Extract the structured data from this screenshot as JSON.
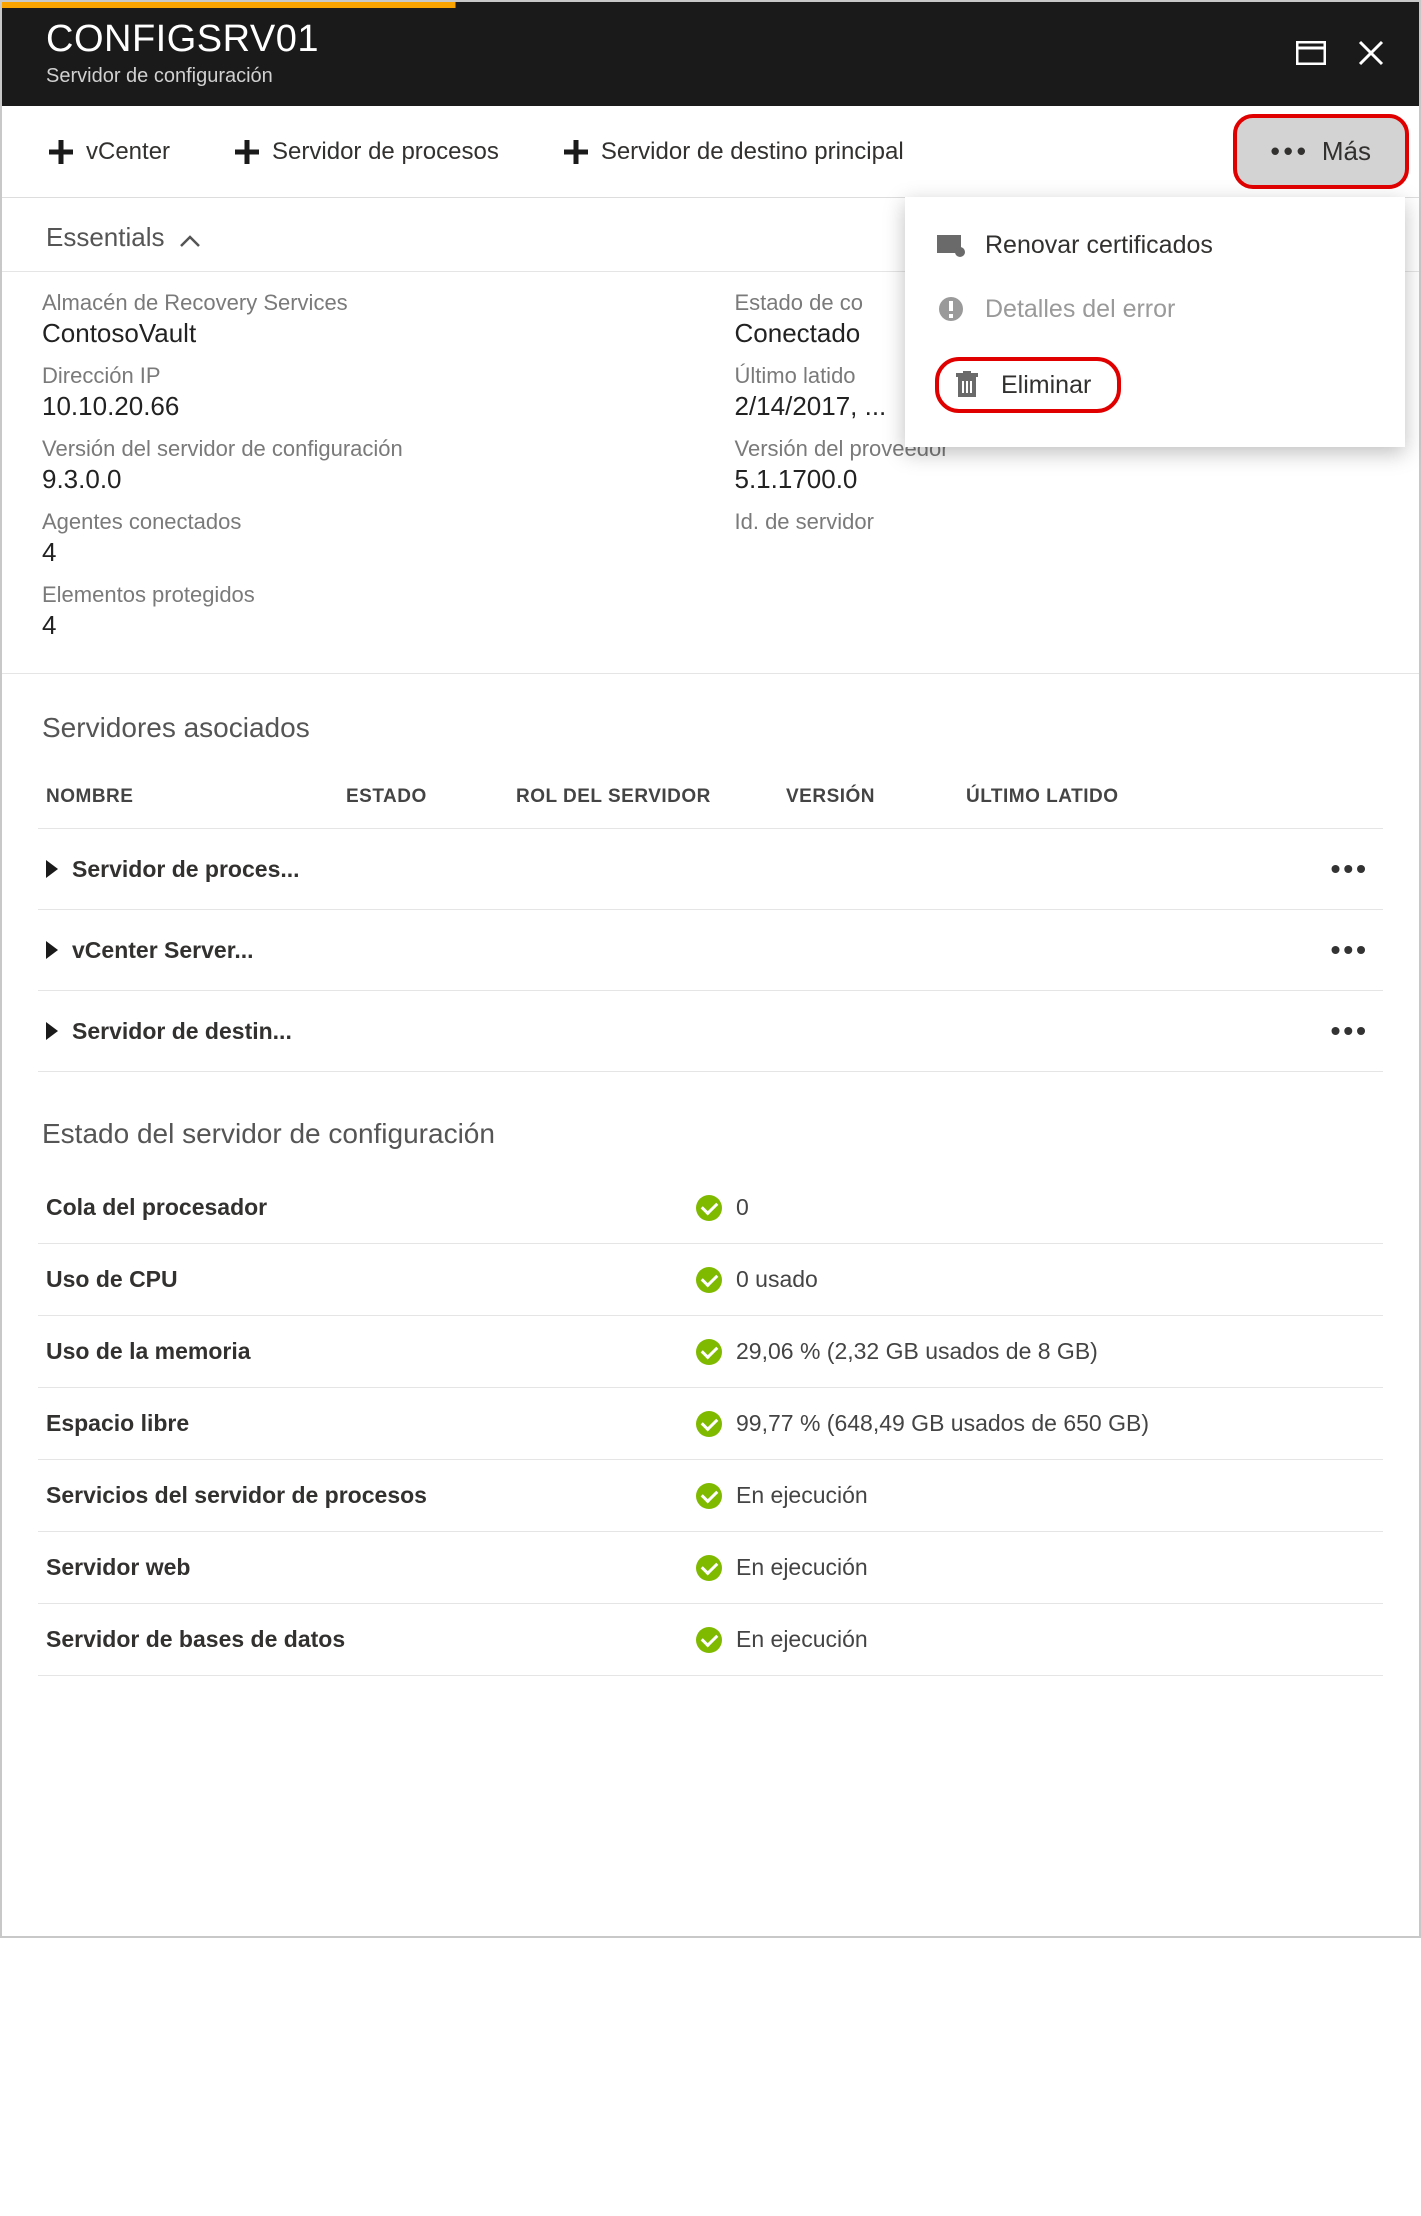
{
  "header": {
    "title": "CONFIGSRV01",
    "subtitle": "Servidor de configuración"
  },
  "toolbar": {
    "items": [
      {
        "label": "vCenter"
      },
      {
        "label": "Servidor de procesos"
      },
      {
        "label": "Servidor de destino principal"
      }
    ],
    "more_label": "Más"
  },
  "more_menu": {
    "renew": "Renovar certificados",
    "error_details": "Detalles del error",
    "delete": "Eliminar"
  },
  "essentials": {
    "toggle": "Essentials",
    "left": {
      "vault_label": "Almacén de Recovery Services",
      "vault_value": "ContosoVault",
      "ip_label": "Dirección IP",
      "ip_value": "10.10.20.66",
      "ver_label": "Versión del servidor de configuración",
      "ver_value": "9.3.0.0",
      "agents_label": "Agentes conectados",
      "agents_value": "4",
      "protected_label": "Elementos protegidos",
      "protected_value": "4"
    },
    "right": {
      "conn_label": "Estado de co",
      "conn_value": "Conectado",
      "beat_label": "Último latido",
      "beat_value": "2/14/2017, ...",
      "prov_label": "Versión del proveedor",
      "prov_value": "5.1.1700.0",
      "srvid_label": "Id. de servidor",
      "srvid_value": ""
    }
  },
  "assoc": {
    "title": "Servidores asociados",
    "headers": {
      "name": "NOMBRE",
      "state": "ESTADO",
      "role": "ROL DEL SERVIDOR",
      "version": "VERSIÓN",
      "heartbeat": "ÚLTIMO LATIDO"
    },
    "rows": [
      {
        "name": "Servidor de proces..."
      },
      {
        "name": "vCenter Server..."
      },
      {
        "name": "Servidor de destin..."
      }
    ]
  },
  "status": {
    "title": "Estado del servidor de configuración",
    "rows": [
      {
        "label": "Cola del procesador",
        "value": "0"
      },
      {
        "label": "Uso de CPU",
        "value": "0 usado"
      },
      {
        "label": "Uso de la memoria",
        "value": "29,06 % (2,32 GB usados de 8 GB)"
      },
      {
        "label": "Espacio libre",
        "value": "99,77 % (648,49 GB usados de 650 GB)"
      },
      {
        "label": "Servicios del servidor de procesos",
        "value": "En ejecución"
      },
      {
        "label": "Servidor web",
        "value": "En ejecución"
      },
      {
        "label": "Servidor de bases de datos",
        "value": "En ejecución"
      }
    ]
  }
}
